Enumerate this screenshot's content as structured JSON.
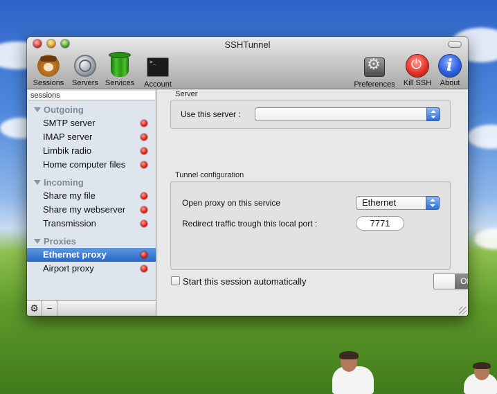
{
  "window": {
    "title": "SSHTunnel"
  },
  "toolbar": {
    "left_buttons": [
      {
        "label": "Sessions",
        "icon": "sessions-icon"
      },
      {
        "label": "Servers",
        "icon": "servers-icon"
      },
      {
        "label": "Services",
        "icon": "services-icon"
      },
      {
        "label": "Account",
        "icon": "account-icon"
      }
    ],
    "right_buttons": [
      {
        "label": "Preferences",
        "icon": "preferences-icon"
      },
      {
        "label": "Kill SSH",
        "icon": "power-icon"
      },
      {
        "label": "About",
        "icon": "about-icon"
      }
    ]
  },
  "sidebar": {
    "header": "sessions",
    "groups": [
      {
        "name": "Outgoing",
        "items": [
          "SMTP server",
          "IMAP server",
          "Limbik radio",
          "Home computer files"
        ]
      },
      {
        "name": "Incoming",
        "items": [
          "Share my file",
          "Share my webserver",
          "Transmission"
        ]
      },
      {
        "name": "Proxies",
        "items": [
          "Ethernet proxy",
          "Airport proxy"
        ]
      }
    ],
    "selected_item": "Ethernet proxy",
    "status_color": "#e21f16",
    "bottom": {
      "gear_symbol": "⚙",
      "remove_symbol": "−"
    }
  },
  "server_section": {
    "title": "Server",
    "use_server_label": "Use this server :",
    "use_server_value": ""
  },
  "tunnel_section": {
    "title": "Tunnel configuration",
    "proxy_label": "Open proxy on this service",
    "proxy_value": "Ethernet",
    "redirect_label": "Redirect traffic trough this local port :",
    "port_value": "7771"
  },
  "auto_start": {
    "label": "Start this session automatically",
    "checked": false
  },
  "toggle": {
    "state_label": "Off"
  }
}
